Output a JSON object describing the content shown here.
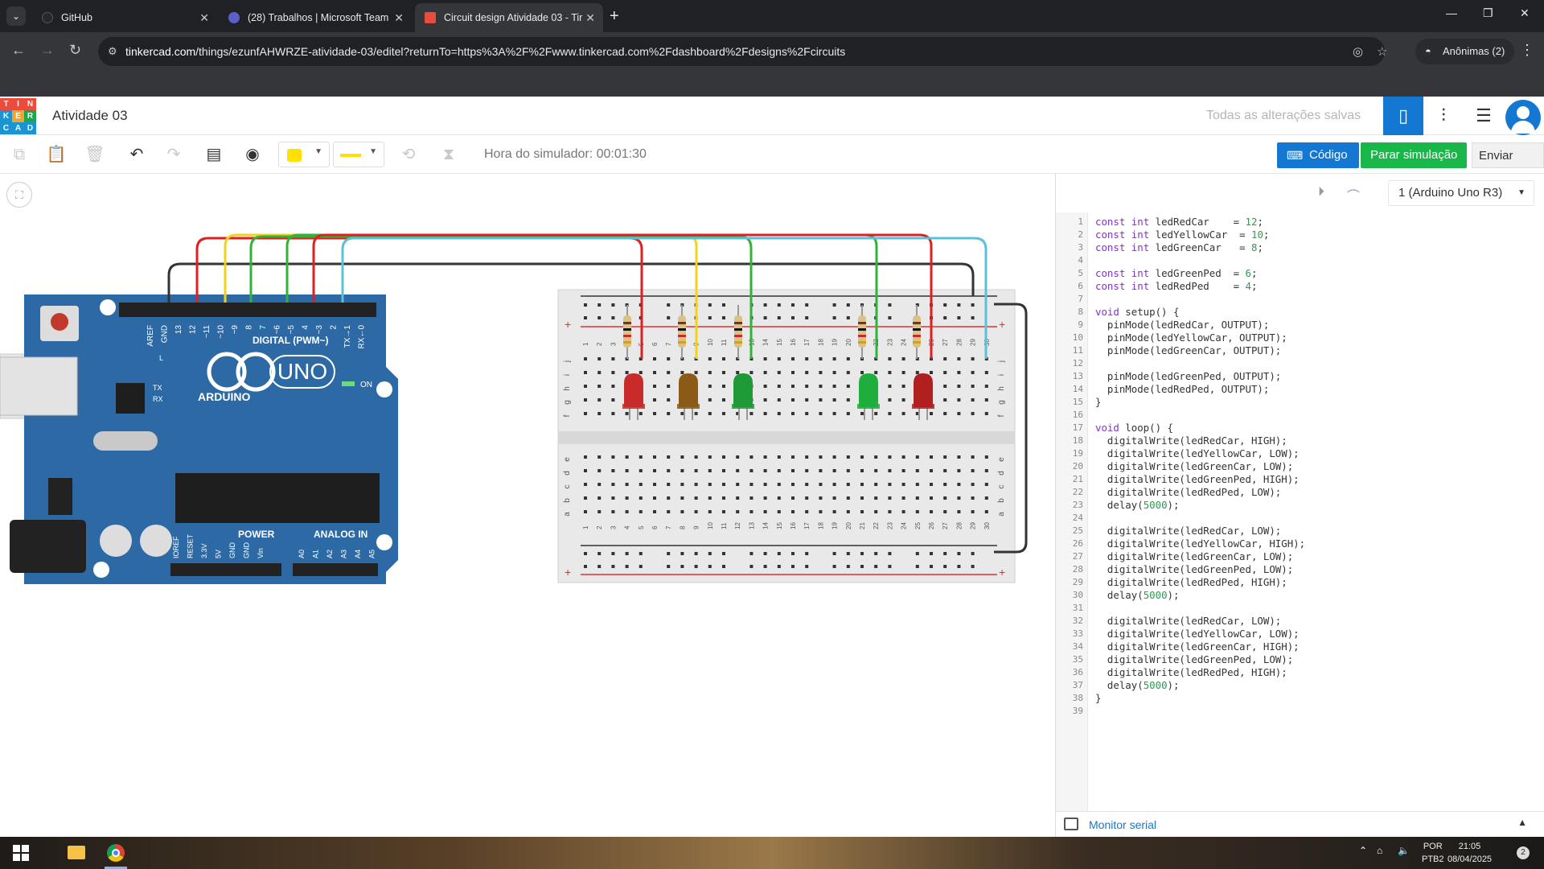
{
  "browser": {
    "tabs": [
      {
        "title": "GitHub",
        "favicon_color": "#24292e"
      },
      {
        "title": "(28) Trabalhos | Microsoft Team",
        "favicon_color": "#5b5fc7"
      },
      {
        "title": "Circuit design Atividade 03 - Tir",
        "favicon_color": "#e94c3d"
      }
    ],
    "url_domain": "tinkercad.com",
    "url_path": "/things/ezunfAHWRZE-atividade-03/editel?returnTo=https%3A%2F%2Fwww.tinkercad.com%2Fdashboard%2Fdesigns%2Fcircuits",
    "profile_label": "Anônimas (2)"
  },
  "header": {
    "logo_letters": [
      "T",
      "I",
      "N",
      "K",
      "E",
      "R",
      "C",
      "A",
      "D"
    ],
    "logo_colors": [
      "#e94c3d",
      "#e94c3d",
      "#e94c3d",
      "#1a94d2",
      "#f3a52b",
      "#1ea54d",
      "#1a94d2",
      "#1a94d2",
      "#1a94d2"
    ],
    "design_name": "Atividade 03",
    "save_status": "Todas as alterações salvas",
    "views": [
      "circuit-view-icon",
      "schematic-view-icon",
      "component-list-icon"
    ]
  },
  "toolbar": {
    "sim_time": "Hora do simulador: 00:01:30",
    "code_label": "Código",
    "stop_sim_label": "Parar simulação",
    "send_label": "Enviar para",
    "color_selected": "#ffe000",
    "wire_color": "#ffe000"
  },
  "code_panel": {
    "device": "1 (Arduino Uno R3)",
    "serial_monitor": "Monitor serial",
    "lines": [
      "const int ledRedCar    = 12;",
      "const int ledYellowCar  = 10;",
      "const int ledGreenCar   = 8;",
      "",
      "const int ledGreenPed  = 6;",
      "const int ledRedPed    = 4;",
      "",
      "void setup() {",
      "  pinMode(ledRedCar, OUTPUT);",
      "  pinMode(ledYellowCar, OUTPUT);",
      "  pinMode(ledGreenCar, OUTPUT);",
      "",
      "  pinMode(ledGreenPed, OUTPUT);",
      "  pinMode(ledRedPed, OUTPUT);",
      "}",
      "",
      "void loop() {",
      "  digitalWrite(ledRedCar, HIGH);",
      "  digitalWrite(ledYellowCar, LOW);",
      "  digitalWrite(ledGreenCar, LOW);",
      "  digitalWrite(ledGreenPed, HIGH);",
      "  digitalWrite(ledRedPed, LOW);",
      "  delay(5000);",
      "",
      "  digitalWrite(ledRedCar, LOW);",
      "  digitalWrite(ledYellowCar, HIGH);",
      "  digitalWrite(ledGreenCar, LOW);",
      "  digitalWrite(ledGreenPed, LOW);",
      "  digitalWrite(ledRedPed, HIGH);",
      "  delay(5000);",
      "",
      "  digitalWrite(ledRedCar, LOW);",
      "  digitalWrite(ledYellowCar, LOW);",
      "  digitalWrite(ledGreenCar, HIGH);",
      "  digitalWrite(ledGreenPed, LOW);",
      "  digitalWrite(ledRedPed, HIGH);",
      "  delay(5000);",
      "}",
      ""
    ]
  },
  "arduino": {
    "brand": "ARDUINO",
    "model": "UNO",
    "digital_label": "DIGITAL (PWM~)",
    "power_label": "POWER",
    "analog_label": "ANALOG IN",
    "on_label": "ON",
    "tx_label": "TX",
    "rx_label": "RX",
    "l_label": "L",
    "digital_pins": [
      "AREF",
      "GND",
      "13",
      "12",
      "~11",
      "~10",
      "~9",
      "8",
      "7",
      "~6",
      "~5",
      "4",
      "~3",
      "2",
      "TX→1",
      "RX←0"
    ],
    "power_pins": [
      "IOREF",
      "RESET",
      "3.3V",
      "5V",
      "GND",
      "GND",
      "Vin"
    ],
    "analog_pins": [
      "A0",
      "A1",
      "A2",
      "A3",
      "A4",
      "A5"
    ],
    "color": "#2d6aa5"
  },
  "breadboard": {
    "leds": [
      {
        "color": "#c92a2a",
        "label": "red-car-led"
      },
      {
        "color": "#8a5a16",
        "label": "yellow-car-led"
      },
      {
        "color": "#1d9a36",
        "label": "green-car-led"
      },
      {
        "color": "#1fae3c",
        "label": "green-ped-led"
      },
      {
        "color": "#b21f1f",
        "label": "red-ped-led"
      }
    ],
    "wire_colors": [
      "#e02020",
      "#f2d21a",
      "#2fb33a",
      "#2fb33a",
      "#e02020",
      "#5bc0d8"
    ],
    "column_numbers": [
      "1",
      "2",
      "3",
      "4",
      "5",
      "6",
      "7",
      "8",
      "9",
      "10",
      "11",
      "12",
      "13",
      "14",
      "15",
      "16",
      "17",
      "18",
      "19",
      "20",
      "21",
      "22",
      "23",
      "24",
      "25",
      "26",
      "27",
      "28",
      "29",
      "30"
    ],
    "row_letters_top": [
      "j",
      "i",
      "h",
      "g",
      "f"
    ],
    "row_letters_bottom": [
      "e",
      "d",
      "c",
      "b",
      "a"
    ]
  },
  "taskbar": {
    "lang": "POR",
    "lang2": "PTB2",
    "time": "21:05",
    "date": "08/04/2025",
    "notifications": "2"
  }
}
